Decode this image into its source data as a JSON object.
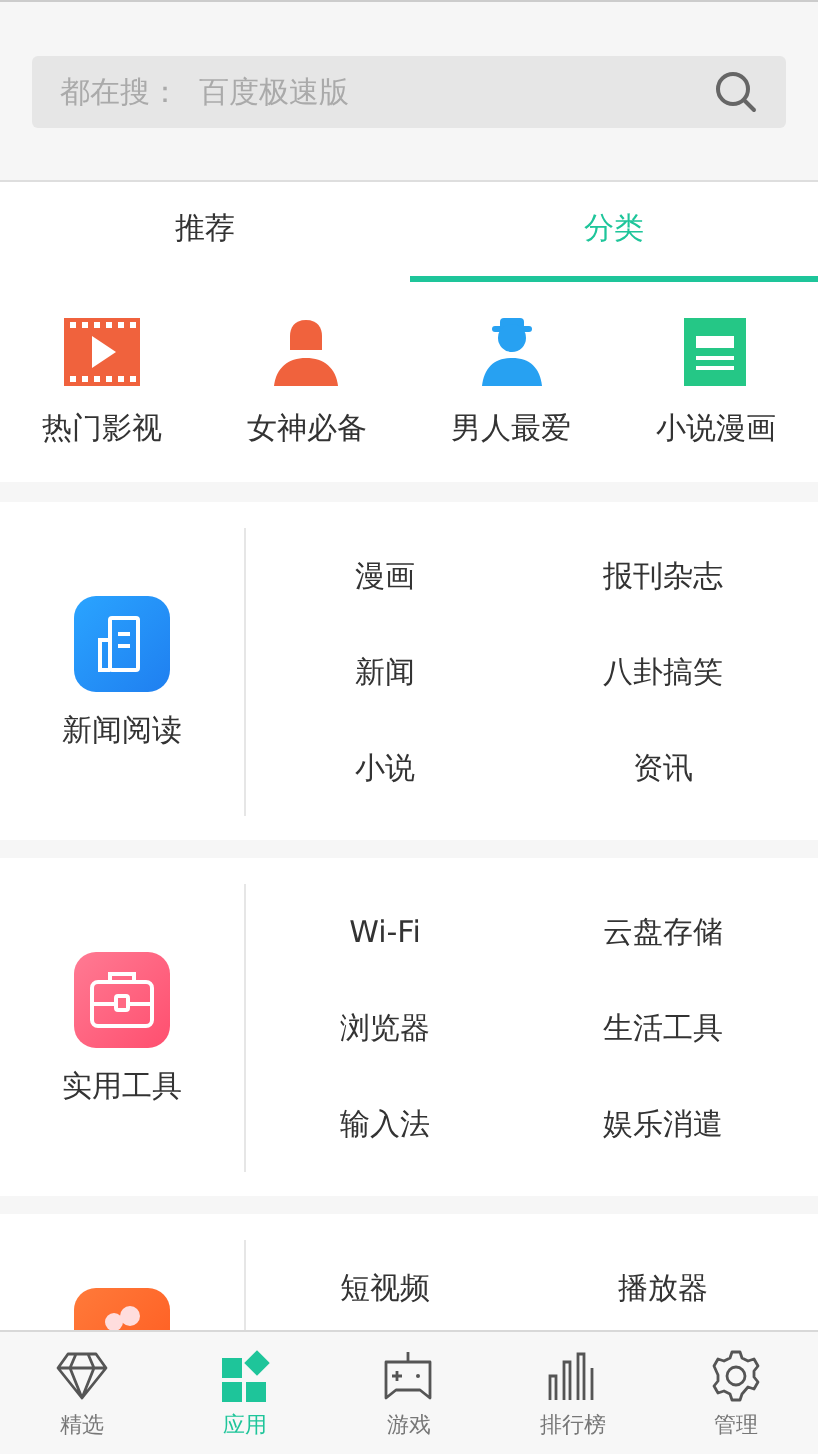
{
  "search": {
    "placeholder": "都在搜：  百度极速版"
  },
  "tabs": [
    {
      "label": "推荐",
      "selected": false
    },
    {
      "label": "分类",
      "selected": true
    }
  ],
  "categories": [
    {
      "label": "热门影视"
    },
    {
      "label": "女神必备"
    },
    {
      "label": "男人最爱"
    },
    {
      "label": "小说漫画"
    }
  ],
  "sections": [
    {
      "title": "新闻阅读",
      "items": [
        "漫画",
        "报刊杂志",
        "新闻",
        "八卦搞笑",
        "小说",
        "资讯"
      ]
    },
    {
      "title": "实用工具",
      "items": [
        "Wi-Fi",
        "云盘存储",
        "浏览器",
        "生活工具",
        "输入法",
        "娱乐消遣"
      ]
    },
    {
      "items": [
        "短视频",
        "播放器"
      ]
    }
  ],
  "bottom_nav": [
    {
      "label": "精选",
      "selected": false
    },
    {
      "label": "应用",
      "selected": true
    },
    {
      "label": "游戏",
      "selected": false
    },
    {
      "label": "排行榜",
      "selected": false
    },
    {
      "label": "管理",
      "selected": false
    }
  ]
}
